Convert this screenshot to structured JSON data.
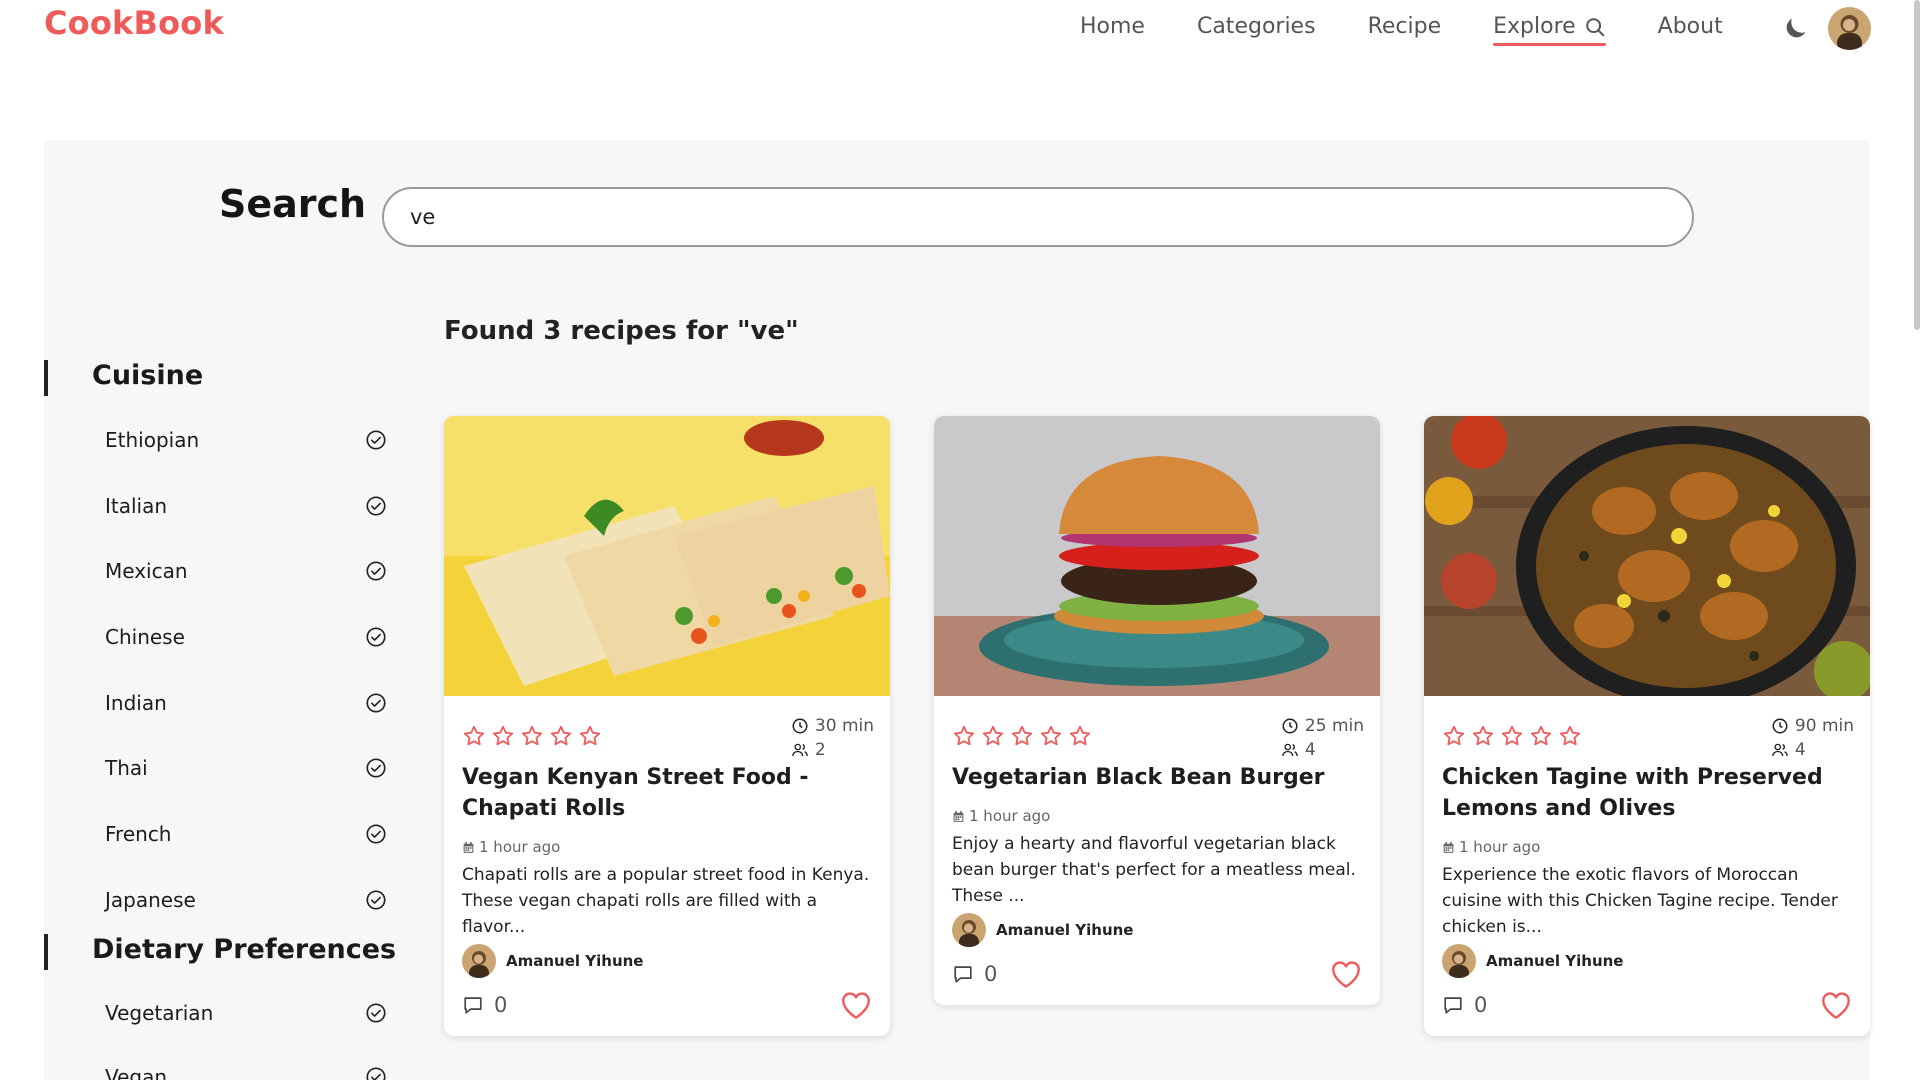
{
  "header": {
    "logo": "CookBook",
    "nav": [
      "Home",
      "Categories",
      "Recipe",
      "Explore",
      "About"
    ],
    "active_nav": "Explore"
  },
  "search": {
    "label": "Search",
    "value": "ve"
  },
  "results": {
    "title": "Found 3 recipes for \"ve\""
  },
  "sidebar": {
    "cuisine_title": "Cuisine",
    "cuisines": [
      "Ethiopian",
      "Italian",
      "Mexican",
      "Chinese",
      "Indian",
      "Thai",
      "French",
      "Japanese"
    ],
    "dietary_title": "Dietary Preferences",
    "dietary": [
      "Vegetarian",
      "Vegan"
    ]
  },
  "cards": [
    {
      "title": "Vegan Kenyan Street Food - Chapati Rolls",
      "time": "30 min",
      "servings": "2",
      "posted": "1 hour ago",
      "description": "Chapati rolls are a popular street food in Kenya. These vegan chapati rolls are filled with a flavor...",
      "author": "Amanuel Yihune",
      "comments": "0",
      "rating": 0
    },
    {
      "title": "Vegetarian Black Bean Burger",
      "time": "25 min",
      "servings": "4",
      "posted": "1 hour ago",
      "description": "Enjoy a hearty and flavorful vegetarian black bean burger that's perfect for a meatless meal. These ...",
      "author": "Amanuel Yihune",
      "comments": "0",
      "rating": 0
    },
    {
      "title": "Chicken Tagine with Preserved Lemons and Olives",
      "time": "90 min",
      "servings": "4",
      "posted": "1 hour ago",
      "description": "Experience the exotic flavors of Moroccan cuisine with this Chicken Tagine recipe. Tender chicken is...",
      "author": "Amanuel Yihune",
      "comments": "0",
      "rating": 0
    }
  ],
  "colors": {
    "brand": "#ef5a5a",
    "panel": "#f7f7f7"
  }
}
